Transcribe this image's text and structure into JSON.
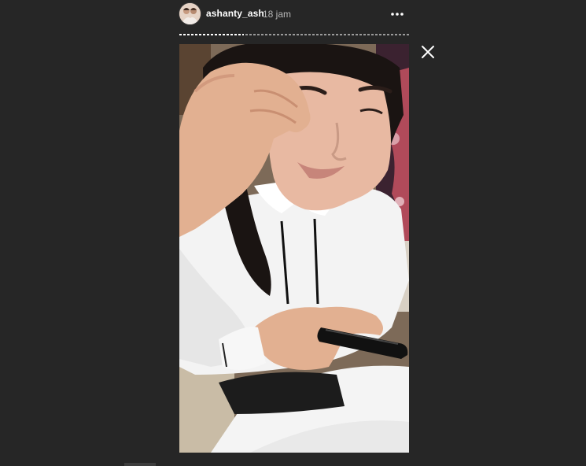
{
  "header": {
    "username": "ashanty_ash",
    "time": "18 jam"
  },
  "icons": {
    "avatar": "profile-avatar",
    "more": "more-options-icon",
    "close": "close-icon"
  },
  "progress": {
    "segments": 2,
    "current": 1
  },
  "colors": {
    "background": "#262626",
    "text": "#ffffff",
    "muted": "#b8b8b8"
  }
}
